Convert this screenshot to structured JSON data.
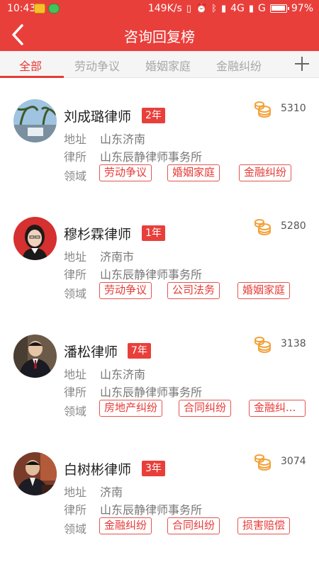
{
  "status": {
    "time": "10:43",
    "speed": "149K/s",
    "net1": "4G",
    "net2": "G",
    "battery": "97%"
  },
  "header": {
    "title": "咨询回复榜"
  },
  "tabs": [
    "全部",
    "劳动争议",
    "婚姻家庭",
    "金融纠纷"
  ],
  "labels": {
    "address": "地址",
    "firm": "律所",
    "field": "领域"
  },
  "lawyers": [
    {
      "name": "刘成璐律师",
      "years": "2年",
      "count": "5310",
      "address": "山东济南",
      "firm": "山东辰静律师事务所",
      "tags": [
        "劳动争议",
        "婚姻家庭",
        "金融纠纷"
      ]
    },
    {
      "name": "穆杉霖律师",
      "years": "1年",
      "count": "5280",
      "address": "济南市",
      "firm": "山东辰静律师事务所",
      "tags": [
        "劳动争议",
        "公司法务",
        "婚姻家庭"
      ]
    },
    {
      "name": "潘松律师",
      "years": "7年",
      "count": "3138",
      "address": "山东济南",
      "firm": "山东辰静律师事务所",
      "tags": [
        "房地产纠纷",
        "合同纠纷",
        "金融纠..."
      ]
    },
    {
      "name": "白树彬律师",
      "years": "3年",
      "count": "3074",
      "address": "济南",
      "firm": "山东辰静律师事务所",
      "tags": [
        "金融纠纷",
        "合同纠纷",
        "损害赔偿"
      ]
    }
  ],
  "colors": {
    "accent": "#e93f3b",
    "tagBorder": "#e25550",
    "coin": "#f2a23a"
  },
  "icons": {
    "back": "chevron-left-icon",
    "add": "plus-icon",
    "coin": "coin-stack-icon"
  }
}
